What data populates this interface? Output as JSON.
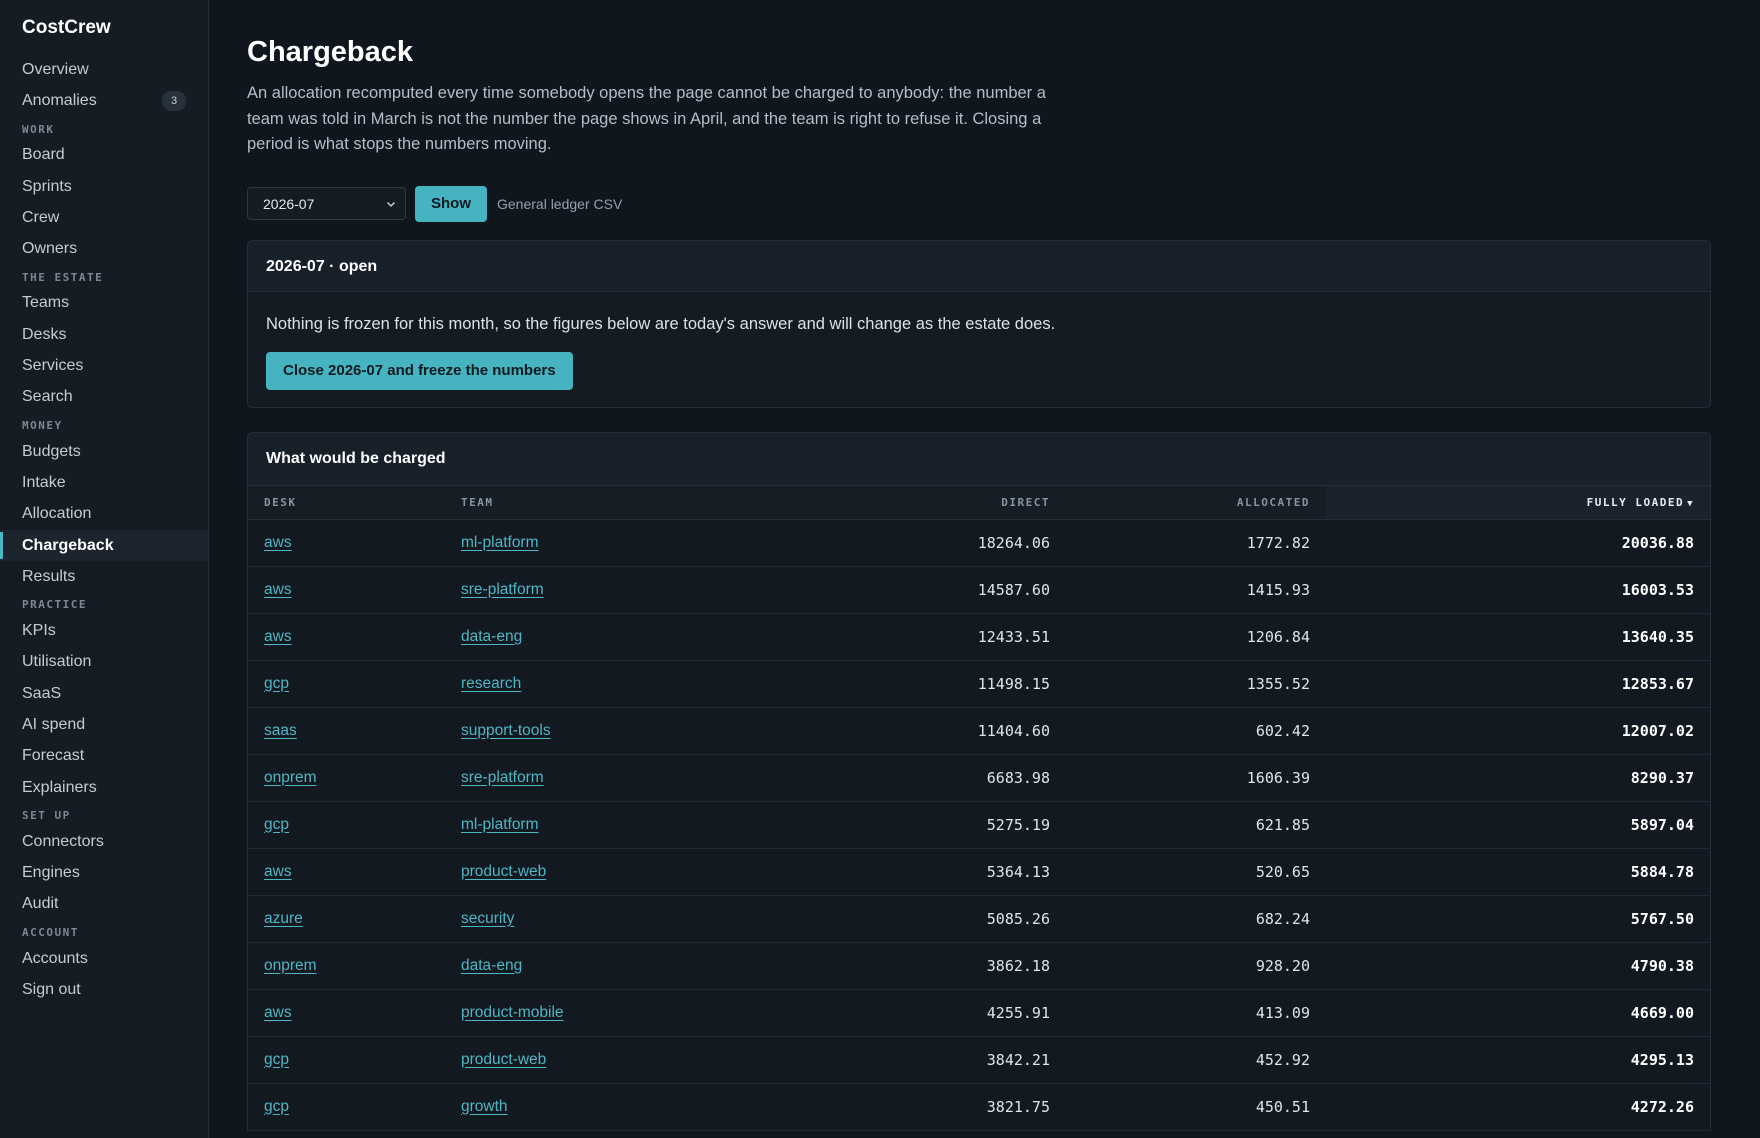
{
  "app": {
    "brand": "CostCrew"
  },
  "sidebar": {
    "top": [
      {
        "label": "Overview"
      },
      {
        "label": "Anomalies",
        "badge": "3"
      }
    ],
    "sections": [
      {
        "title": "WORK",
        "items": [
          "Board",
          "Sprints",
          "Crew",
          "Owners"
        ]
      },
      {
        "title": "THE ESTATE",
        "items": [
          "Teams",
          "Desks",
          "Services",
          "Search"
        ]
      },
      {
        "title": "MONEY",
        "items": [
          "Budgets",
          "Intake",
          "Allocation",
          "Chargeback",
          "Results"
        ]
      },
      {
        "title": "PRACTICE",
        "items": [
          "KPIs",
          "Utilisation",
          "SaaS",
          "AI spend",
          "Forecast",
          "Explainers"
        ]
      },
      {
        "title": "SET UP",
        "items": [
          "Connectors",
          "Engines",
          "Audit"
        ]
      },
      {
        "title": "ACCOUNT",
        "items": [
          "Accounts",
          "Sign out"
        ]
      }
    ],
    "active": "Chargeback"
  },
  "page": {
    "title": "Chargeback",
    "intro": "An allocation recomputed every time somebody opens the page cannot be charged to anybody: the number a team was told in March is not the number the page shows in April, and the team is right to refuse it. Closing a period is what stops the numbers moving."
  },
  "controls": {
    "period_value": "2026-07",
    "show_label": "Show",
    "csv_label": "General ledger CSV"
  },
  "status_panel": {
    "title": "2026-07 · open",
    "message": "Nothing is frozen for this month, so the figures below are today's answer and will change as the estate does.",
    "close_button": "Close 2026-07 and freeze the numbers"
  },
  "charges": {
    "title": "What would be charged",
    "columns": {
      "desk": "DESK",
      "team": "TEAM",
      "direct": "DIRECT",
      "allocated": "ALLOCATED",
      "fully_loaded": "FULLY LOADED"
    },
    "sort_indicator": "▼",
    "rows": [
      {
        "desk": "aws",
        "team": "ml-platform",
        "direct": "18264.06",
        "allocated": "1772.82",
        "fully_loaded": "20036.88"
      },
      {
        "desk": "aws",
        "team": "sre-platform",
        "direct": "14587.60",
        "allocated": "1415.93",
        "fully_loaded": "16003.53"
      },
      {
        "desk": "aws",
        "team": "data-eng",
        "direct": "12433.51",
        "allocated": "1206.84",
        "fully_loaded": "13640.35"
      },
      {
        "desk": "gcp",
        "team": "research",
        "direct": "11498.15",
        "allocated": "1355.52",
        "fully_loaded": "12853.67"
      },
      {
        "desk": "saas",
        "team": "support-tools",
        "direct": "11404.60",
        "allocated": "602.42",
        "fully_loaded": "12007.02"
      },
      {
        "desk": "onprem",
        "team": "sre-platform",
        "direct": "6683.98",
        "allocated": "1606.39",
        "fully_loaded": "8290.37"
      },
      {
        "desk": "gcp",
        "team": "ml-platform",
        "direct": "5275.19",
        "allocated": "621.85",
        "fully_loaded": "5897.04"
      },
      {
        "desk": "aws",
        "team": "product-web",
        "direct": "5364.13",
        "allocated": "520.65",
        "fully_loaded": "5884.78"
      },
      {
        "desk": "azure",
        "team": "security",
        "direct": "5085.26",
        "allocated": "682.24",
        "fully_loaded": "5767.50"
      },
      {
        "desk": "onprem",
        "team": "data-eng",
        "direct": "3862.18",
        "allocated": "928.20",
        "fully_loaded": "4790.38"
      },
      {
        "desk": "aws",
        "team": "product-mobile",
        "direct": "4255.91",
        "allocated": "413.09",
        "fully_loaded": "4669.00"
      },
      {
        "desk": "gcp",
        "team": "product-web",
        "direct": "3842.21",
        "allocated": "452.92",
        "fully_loaded": "4295.13"
      },
      {
        "desk": "gcp",
        "team": "growth",
        "direct": "3821.75",
        "allocated": "450.51",
        "fully_loaded": "4272.26"
      }
    ]
  }
}
